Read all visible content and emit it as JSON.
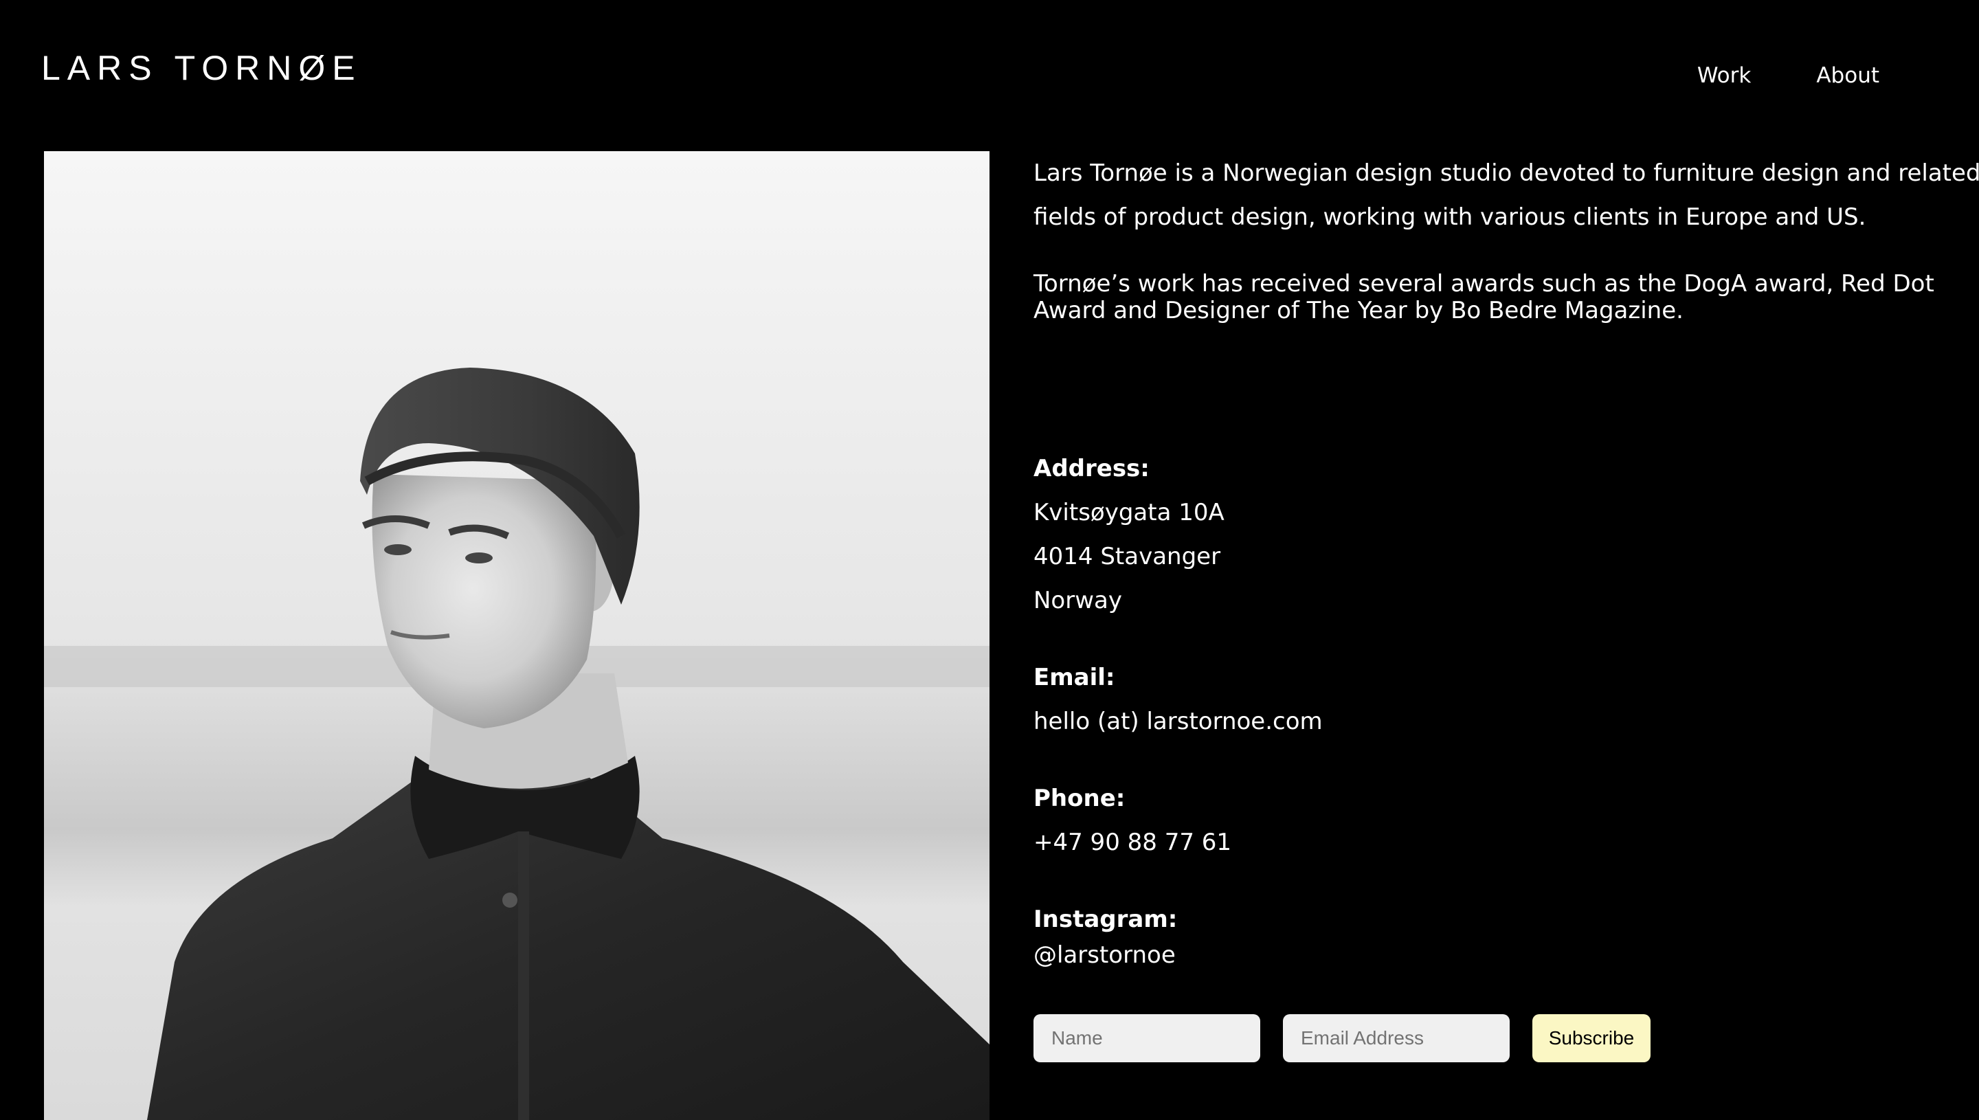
{
  "header": {
    "logo_text": "LARS TORNØE",
    "nav": {
      "work": "Work",
      "about": "About"
    }
  },
  "intro": {
    "line1": "Lars Tornøe is a Norwegian design studio devoted to furniture design and related",
    "line2": "fields of product design, working with various clients in Europe and US."
  },
  "awards": {
    "line1": "Tornøe’s work has received several awards such as the DogA award, Red Dot",
    "line2": "Award and Designer of The Year by Bo Bedre Magazine."
  },
  "contact": {
    "address_label": "Address:",
    "address_lines": [
      "Kvitsøygata 10A",
      "4014 Stavanger",
      "Norway"
    ],
    "email_label": "Email:",
    "email_value": "hello (at) larstornoe.com",
    "phone_label": "Phone:",
    "phone_value": "+47 90 88 77 61",
    "instagram_label": "Instagram:",
    "instagram_value": "@larstornoe"
  },
  "subscribe": {
    "name_placeholder": "Name",
    "email_placeholder": "Email Address",
    "button_label": "Subscribe",
    "button_color": "#fbf7c4"
  },
  "colors": {
    "background": "#000000",
    "text": "#ffffff",
    "field_background": "#f0f0f0"
  }
}
